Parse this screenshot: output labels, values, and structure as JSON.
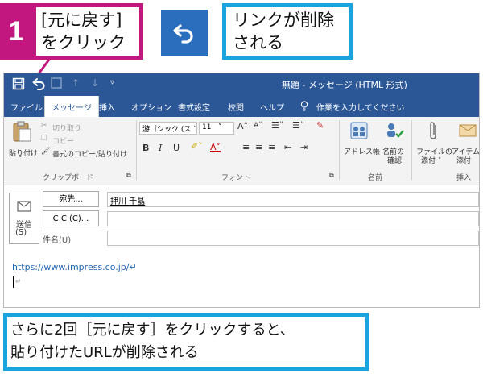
{
  "callout": {
    "step_number": "1",
    "step_text_line1": "[元に戻す]",
    "step_text_line2": "をクリック",
    "result_line1": "リンクが削除",
    "result_line2": "される",
    "step_color": "#c2177e",
    "result_color": "#1aa4df",
    "undo_icon": "undo-icon"
  },
  "window": {
    "title": "無題 - メッセージ (HTML 形式)",
    "qat": {
      "save_icon": "save-icon",
      "undo_icon": "undo-icon",
      "redo_icon": "redo-icon",
      "up_arrow": "↑",
      "down_arrow": "↓",
      "more": "▿"
    },
    "tabs": [
      "ファイル",
      "メッセージ",
      "挿入",
      "オプション",
      "書式設定",
      "校閲",
      "ヘルプ"
    ],
    "active_tab": "メッセージ",
    "tell_me": "作業を入力してください",
    "ribbon": {
      "paste": "貼り付け",
      "cut": "切り取り",
      "copy": "コピー",
      "format_painter": "書式のコピー/貼り付け",
      "clipboard_group": "クリップボード",
      "font_name": "游ゴシック (ス",
      "font_size": "11",
      "font_group": "フォント",
      "address_book": "アドレス帳",
      "check_names_line1": "名前の",
      "check_names_line2": "確認",
      "names_group": "名前",
      "attach_file_line1": "ファイルの",
      "attach_file_line2": "添付 ˅",
      "attach_item_line1": "アイテム",
      "attach_item_line2": "添付",
      "insert_group": "挿入"
    },
    "fields": {
      "send_line1": "送信",
      "send_line2": "(S)",
      "to_button": "宛先...",
      "to_value": "押川 千晶",
      "cc_button": "C C (C)...",
      "subject_label": "件名(U)"
    },
    "body_link": "https://www.impress.co.jp/↵",
    "body_cursor_mark": "↵"
  },
  "caption": {
    "line1": "さらに2回［元に戻す］をクリックすると、",
    "line2": "貼り付けたURLが削除される"
  }
}
